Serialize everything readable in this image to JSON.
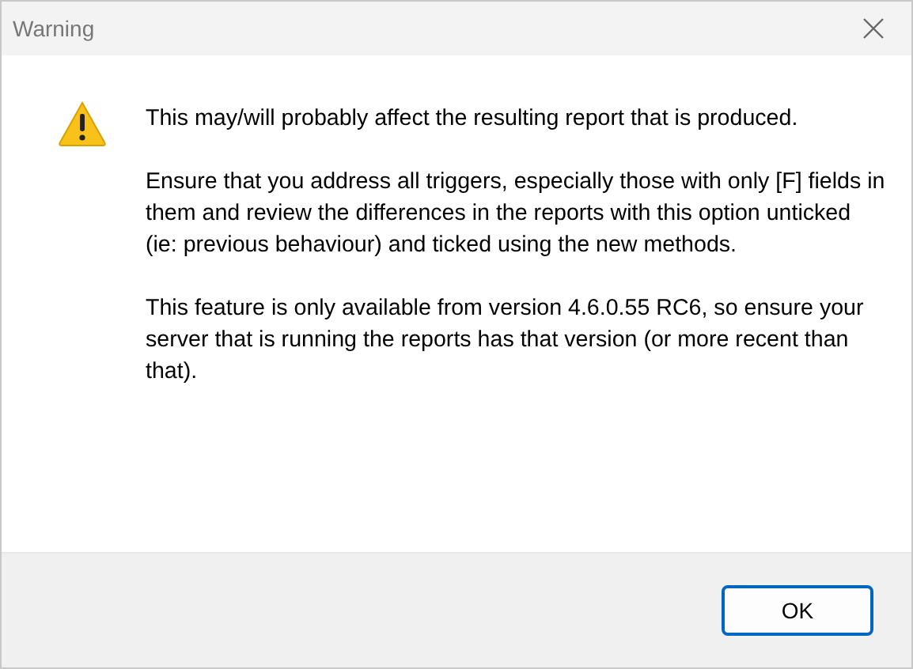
{
  "window": {
    "title": "Warning"
  },
  "message": [
    "This may/will probably affect the resulting report that is produced.",
    "Ensure that you address all triggers, especially those with only [F] fields in them and review the differences in the reports with this option unticked (ie: previous behaviour) and ticked using the new methods.",
    "This feature is only available from version 4.6.0.55 RC6, so ensure your server that is running the reports has that version (or more recent than that)."
  ],
  "buttons": [
    "OK"
  ]
}
